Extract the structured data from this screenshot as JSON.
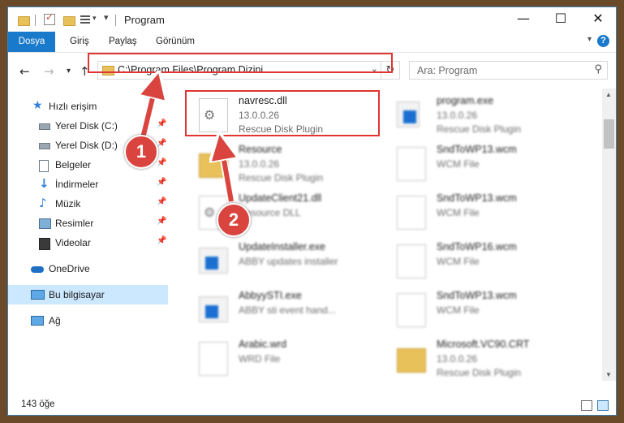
{
  "window": {
    "title": "Program",
    "controls": {
      "minimize": "—",
      "maximize": "☐",
      "close": "✕"
    }
  },
  "ribbon": {
    "tabs": [
      "Dosya",
      "Giriş",
      "Paylaş",
      "Görünüm"
    ],
    "help": "?"
  },
  "nav": {
    "back": "←",
    "forward": "→",
    "recent": "▾",
    "up": "↑",
    "address": "C:\\Program Files\\Program Dizini",
    "search_placeholder": "Ara: Program"
  },
  "sidebar": {
    "items": [
      {
        "label": "Hızlı erişim",
        "icon": "star-icon",
        "pinned": false
      },
      {
        "label": "Yerel Disk (C:)",
        "icon": "drive-icon",
        "pinned": true
      },
      {
        "label": "Yerel Disk (D:)",
        "icon": "drive-icon",
        "pinned": true
      },
      {
        "label": "Belgeler",
        "icon": "documents-icon",
        "pinned": true
      },
      {
        "label": "İndirmeler",
        "icon": "downloads-icon",
        "pinned": true
      },
      {
        "label": "Müzik",
        "icon": "music-icon",
        "pinned": true
      },
      {
        "label": "Resimler",
        "icon": "pictures-icon",
        "pinned": true
      },
      {
        "label": "Videolar",
        "icon": "videos-icon",
        "pinned": true
      },
      {
        "label": "OneDrive",
        "icon": "cloud-icon",
        "pinned": false
      },
      {
        "label": "Bu bilgisayar",
        "icon": "computer-icon",
        "pinned": false,
        "selected": true
      },
      {
        "label": "Ağ",
        "icon": "network-icon",
        "pinned": false
      }
    ]
  },
  "files": [
    {
      "name": "navresc.dll",
      "line1": "13.0.0.26",
      "line2": "Rescue Disk Plugin",
      "icon": "dll-icon",
      "highlighted": true
    },
    {
      "name": "program.exe",
      "line1": "13.0.0.26",
      "line2": "Rescue Disk Plugin",
      "icon": "exe-icon"
    },
    {
      "name": "Resource",
      "line1": "13.0.0.26",
      "line2": "Rescue Disk Plugin",
      "icon": "folder-icon"
    },
    {
      "name": "SndToWP13.wcm",
      "line1": "WCM File",
      "line2": "",
      "icon": "file-icon"
    },
    {
      "name": "UpdateClient21.dll",
      "line1": "Resource DLL",
      "line2": "",
      "icon": "dll-icon"
    },
    {
      "name": "SndToWP13.wcm",
      "line1": "WCM File",
      "line2": "",
      "icon": "file-icon"
    },
    {
      "name": "UpdateInstaller.exe",
      "line1": "ABBY updates installer",
      "line2": "",
      "icon": "exe-icon"
    },
    {
      "name": "SndToWP16.wcm",
      "line1": "WCM File",
      "line2": "",
      "icon": "file-icon"
    },
    {
      "name": "AbbyySTI.exe",
      "line1": "ABBY sti event hand...",
      "line2": "",
      "icon": "exe-icon"
    },
    {
      "name": "SndToWP13.wcm",
      "line1": "WCM File",
      "line2": "",
      "icon": "file-icon"
    },
    {
      "name": "Arabic.wrd",
      "line1": "WRD File",
      "line2": "",
      "icon": "file-icon"
    },
    {
      "name": "Microsoft.VC90.CRT",
      "line1": "13.0.0.26",
      "line2": "Rescue Disk Plugin",
      "icon": "folder-icon"
    }
  ],
  "status": {
    "count": "143 öğe"
  },
  "annotations": {
    "step1": "1",
    "step2": "2"
  },
  "colors": {
    "accent": "#1979ca",
    "highlight": "#e03535",
    "badge": "#d9443f",
    "selection": "#cce8ff"
  }
}
